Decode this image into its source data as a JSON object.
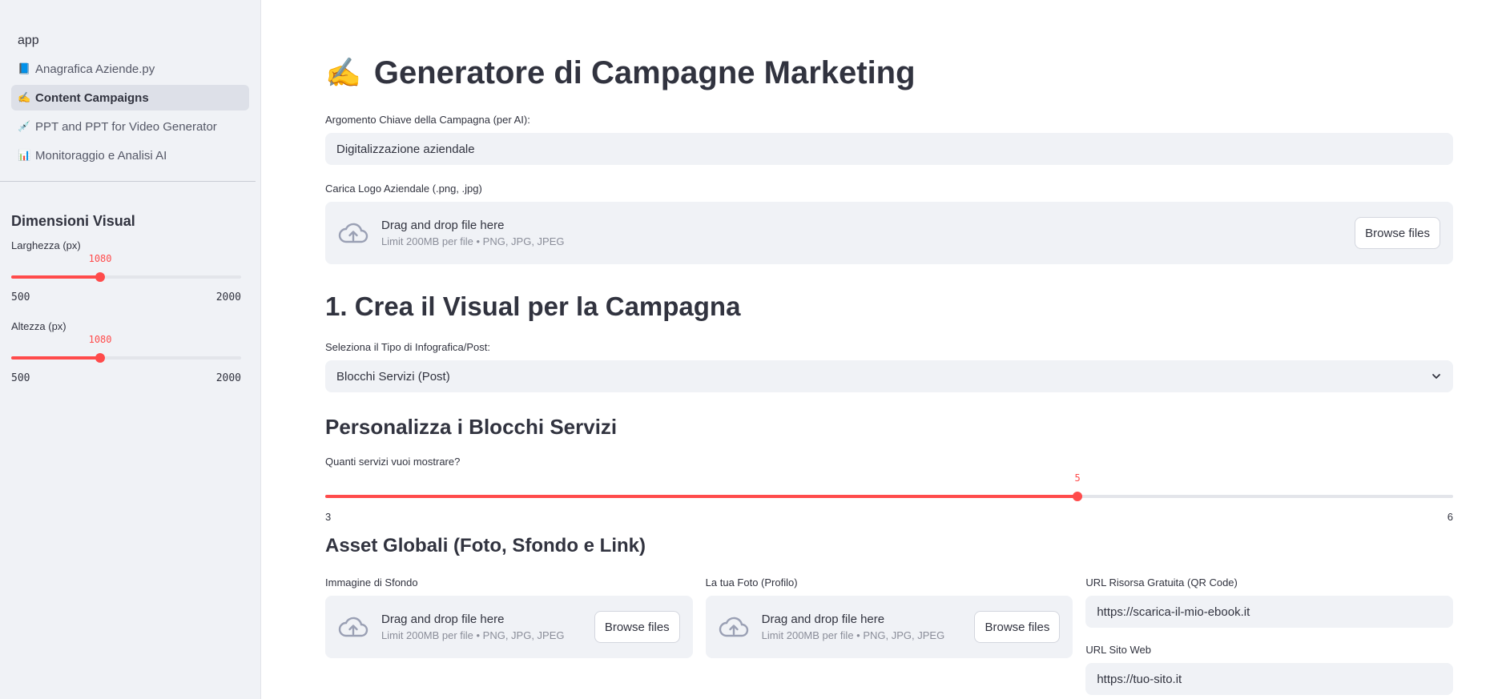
{
  "sidebar": {
    "app_label": "app",
    "items": [
      {
        "icon": "📘",
        "icon_name": "book-icon",
        "label": "Anagrafica Aziende.py",
        "active": false
      },
      {
        "icon": "✍️",
        "icon_name": "writing-hand-icon",
        "label": "Content Campaigns",
        "active": true
      },
      {
        "icon": "💉",
        "icon_name": "syringe-icon",
        "label": "PPT and PPT for Video Generator",
        "active": false
      },
      {
        "icon": "📊",
        "icon_name": "bar-chart-icon",
        "label": "Monitoraggio e Analisi AI",
        "active": false
      }
    ],
    "section_title": "Dimensioni Visual",
    "width_slider": {
      "label": "Larghezza (px)",
      "value": "1080",
      "min": "500",
      "max": "2000",
      "fraction": 0.387
    },
    "height_slider": {
      "label": "Altezza (px)",
      "value": "1080",
      "min": "500",
      "max": "2000",
      "fraction": 0.387
    }
  },
  "main": {
    "title_emoji": "✍️",
    "title": "Generatore di Campagne Marketing",
    "topic_label": "Argomento Chiave della Campagna (per AI):",
    "topic_value": "Digitalizzazione aziendale",
    "logo_label": "Carica Logo Aziendale (.png, .jpg)",
    "uploader": {
      "title": "Drag and drop file here",
      "subtitle": "Limit 200MB per file • PNG, JPG, JPEG",
      "button": "Browse files"
    },
    "section1_title": "1. Crea il Visual per la Campagna",
    "type_label": "Seleziona il Tipo di Infografica/Post:",
    "type_value": "Blocchi Servizi (Post)",
    "customize_title": "Personalizza i Blocchi Servizi",
    "services_slider": {
      "label": "Quanti servizi vuoi mostrare?",
      "value": "5",
      "min": "3",
      "max": "6",
      "fraction": 0.667
    },
    "assets_title": "Asset Globali (Foto, Sfondo e Link)",
    "bg_label": "Immagine di Sfondo",
    "photo_label": "La tua Foto (Profilo)",
    "free_url_label": "URL Risorsa Gratuita (QR Code)",
    "free_url_value": "https://scarica-il-mio-ebook.it",
    "site_url_label": "URL Sito Web",
    "site_url_value": "https://tuo-sito.it"
  },
  "colors": {
    "accent": "#ff4b4b",
    "sidebar_bg": "#f0f2f6",
    "input_bg": "#f0f2f6",
    "text": "#31333f"
  }
}
